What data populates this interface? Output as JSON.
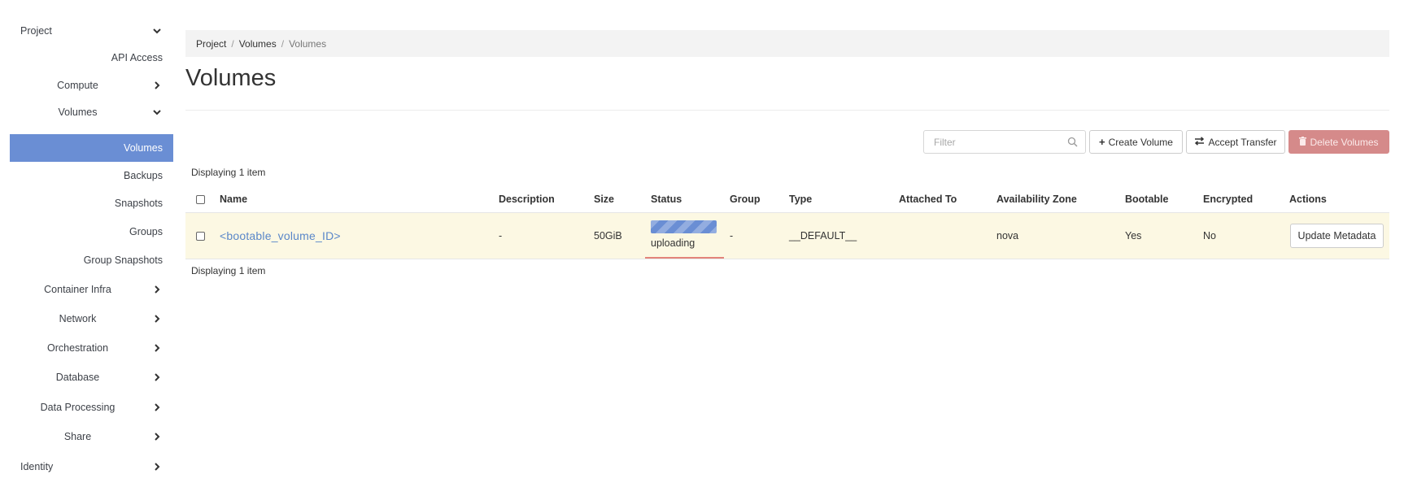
{
  "sidebar": {
    "items": [
      {
        "label": "Project",
        "chevron": "down"
      },
      {
        "label": "API Access"
      },
      {
        "label": "Compute",
        "chevron": "right"
      },
      {
        "label": "Volumes",
        "chevron": "down"
      },
      {
        "label": "Volumes",
        "active": true
      },
      {
        "label": "Backups"
      },
      {
        "label": "Snapshots"
      },
      {
        "label": "Groups"
      },
      {
        "label": "Group Snapshots"
      },
      {
        "label": "Container Infra",
        "chevron": "right"
      },
      {
        "label": "Network",
        "chevron": "right"
      },
      {
        "label": "Orchestration",
        "chevron": "right"
      },
      {
        "label": "Database",
        "chevron": "right"
      },
      {
        "label": "Data Processing",
        "chevron": "right"
      },
      {
        "label": "Share",
        "chevron": "right"
      },
      {
        "label": "Identity",
        "chevron": "right"
      }
    ]
  },
  "breadcrumb": [
    "Project",
    "Volumes",
    "Volumes"
  ],
  "page": {
    "title": "Volumes"
  },
  "actions": {
    "filter_placeholder": "Filter",
    "create_label": "Create Volume",
    "accept_label": "Accept Transfer",
    "delete_label": "Delete Volumes"
  },
  "table": {
    "count_top": "Displaying 1 item",
    "count_bottom": "Displaying 1 item",
    "columns": [
      "Name",
      "Description",
      "Size",
      "Status",
      "Group",
      "Type",
      "Attached To",
      "Availability Zone",
      "Bootable",
      "Encrypted",
      "Actions"
    ],
    "rows": [
      {
        "name": "<bootable_volume_ID>",
        "description": "-",
        "size": "50GiB",
        "status": "uploading",
        "group": "-",
        "type": "__DEFAULT__",
        "attached_to": "",
        "availability_zone": "nova",
        "bootable": "Yes",
        "encrypted": "No",
        "action": "Update Metadata"
      }
    ]
  },
  "colors": {
    "accent": "#6a8ed4",
    "link": "#5a87c9",
    "row_highlight": "#fcf8e3",
    "danger": "#d58a8a",
    "breadcrumb_bg": "#f3f3f3"
  },
  "icons": {
    "expanded": "chevron-down-icon",
    "collapsed": "chevron-right-icon",
    "filter": "search-icon",
    "create": "plus-icon",
    "accept": "transfer-icon",
    "delete": "trash-icon"
  }
}
